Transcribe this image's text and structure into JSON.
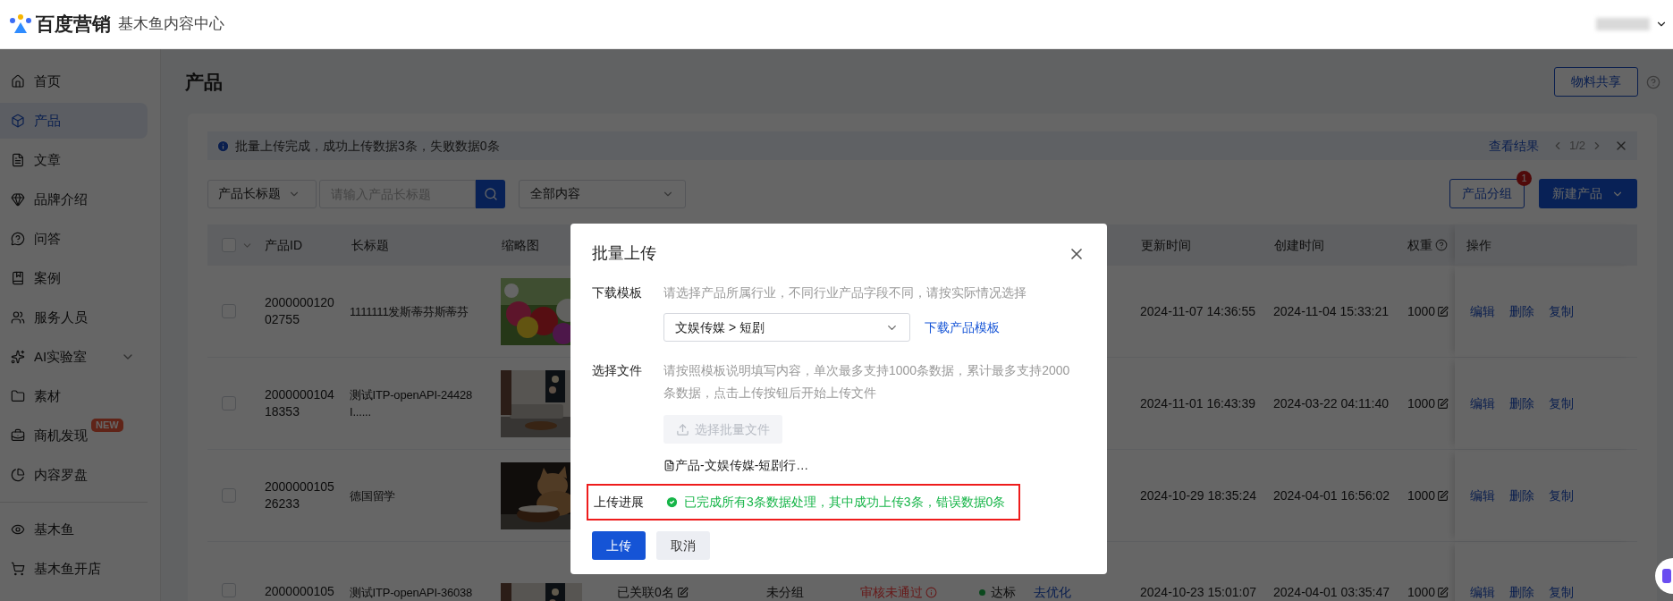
{
  "header": {
    "brand": "百度营销",
    "product": "基木鱼内容中心"
  },
  "sidebar": {
    "items": [
      {
        "label": "首页",
        "kind": "link",
        "selected": false
      },
      {
        "label": "产品",
        "kind": "link",
        "selected": true
      },
      {
        "label": "文章",
        "kind": "link",
        "selected": false
      },
      {
        "label": "品牌介绍",
        "kind": "link",
        "selected": false
      },
      {
        "label": "问答",
        "kind": "link",
        "selected": false
      },
      {
        "label": "案例",
        "kind": "link",
        "selected": false
      },
      {
        "label": "服务人员",
        "kind": "link",
        "selected": false
      },
      {
        "label": "AI实验室",
        "kind": "group",
        "selected": false,
        "expanded": false
      },
      {
        "label": "素材",
        "kind": "link",
        "selected": false
      },
      {
        "label": "商机发现",
        "kind": "link",
        "selected": false,
        "badge": "NEW"
      },
      {
        "label": "内容罗盘",
        "kind": "link",
        "selected": false
      }
    ],
    "footer_items": [
      {
        "label": "基木鱼",
        "selected": false
      },
      {
        "label": "基木鱼开店",
        "selected": false
      }
    ]
  },
  "page": {
    "title": "产品",
    "share_button": "物料共享"
  },
  "notice": {
    "text": "批量上传完成，成功上传数据3条，失败数据0条",
    "link": "查看结果",
    "pager": "1/2"
  },
  "filters": {
    "field_select": "产品长标题",
    "search": {
      "placeholder": "请输入产品长标题"
    },
    "scope_select": "全部内容"
  },
  "actions": {
    "group_button": "产品分组",
    "group_badge": "1",
    "new_button": "新建产品"
  },
  "table": {
    "all_checked": false,
    "columns": [
      {
        "label": "产品ID"
      },
      {
        "label": "长标题"
      },
      {
        "label": "缩略图"
      },
      {
        "label": "更新时间"
      },
      {
        "label": "创建时间"
      },
      {
        "label": "权重"
      },
      {
        "label": "操作"
      }
    ],
    "rows": [
      {
        "checked": false,
        "id_lines": [
          "2000000120",
          "02755"
        ],
        "title_lines": [
          "1111111发斯蒂芬斯蒂芬"
        ],
        "thumbnail": {
          "kind": "picture"
        },
        "updated": "2024-11-07 14:36:55",
        "created": "2024-11-04 15:33:21",
        "weight": "1000",
        "actions": [
          "编辑",
          "删除",
          "复制"
        ]
      },
      {
        "checked": false,
        "id_lines": [
          "2000000104",
          "18353"
        ],
        "title_lines": [
          "测试ITP-openAPI-24428",
          "I......"
        ],
        "thumbnail": {
          "kind": "picture"
        },
        "updated": "2024-11-01 16:43:39",
        "created": "2024-03-22 04:11:40",
        "weight": "1000",
        "actions": [
          "编辑",
          "删除",
          "复制"
        ]
      },
      {
        "checked": false,
        "id_lines": [
          "2000000105",
          "26233"
        ],
        "title_lines": [
          "德国留学"
        ],
        "thumbnail": {
          "kind": "picture"
        },
        "updated": "2024-10-29 18:35:24",
        "created": "2024-04-01 16:56:02",
        "weight": "1000",
        "actions": [
          "编辑",
          "删除",
          "复制"
        ]
      },
      {
        "checked": false,
        "id_lines": [
          "2000000105"
        ],
        "title_lines": [
          "测试ITP-openAPI-36038"
        ],
        "thumbnail": {
          "kind": "picture"
        },
        "column_5": "已关联0名",
        "column_6": "未分组",
        "column_7": "审核未通过",
        "column_8": {
          "status": "达标",
          "link": "去优化"
        },
        "updated": "2024-10-23 15:01:07",
        "created": "2024-04-01 03:35:47",
        "weight": "1000",
        "actions": [
          "编辑",
          "删除",
          "复制"
        ]
      }
    ]
  },
  "dialog": {
    "title": "批量上传",
    "template": {
      "label": "下载模板",
      "hint": "请选择产品所属行业，不同行业产品字段不同，请按实际情况选择",
      "select_value": "文娱传媒 > 短剧",
      "link": "下载产品模板"
    },
    "file": {
      "label": "选择文件",
      "hint": "请按照模板说明填写内容，单次最多支持1000条数据，累计最多支持2000条数据，点击上传按钮后开始上传文件",
      "button": "选择批量文件",
      "button_disabled": true,
      "file_name": "产品-文娱传媒-短剧行…"
    },
    "progress": {
      "label": "上传进展",
      "kind": "success",
      "text": "已完成所有3条数据处理，其中成功上传3条，错误数据0条",
      "highlighted": true
    },
    "buttons": [
      {
        "label": "上传",
        "kind": "primary"
      },
      {
        "label": "取消",
        "kind": "secondary"
      }
    ]
  }
}
